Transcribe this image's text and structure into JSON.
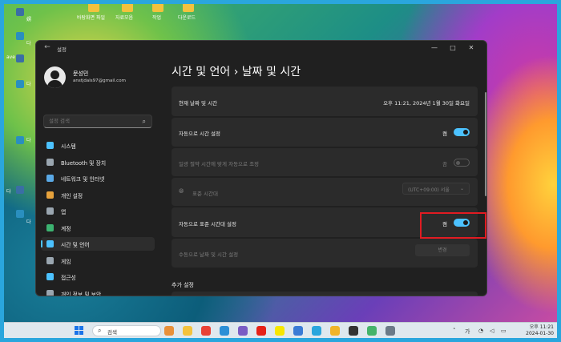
{
  "desktop": {
    "icons": [
      {
        "label": "바탕화면 파일"
      },
      {
        "label": "자료모음"
      },
      {
        "label": "작업"
      },
      {
        "label": "다운로드"
      }
    ],
    "left_labels": [
      "娚",
      "다",
      "ave",
      "다",
      "다",
      "다",
      "다"
    ]
  },
  "window": {
    "app_title": "설정",
    "back_glyph": "←",
    "minimize_glyph": "—",
    "maximize_glyph": "□",
    "close_glyph": "✕"
  },
  "user": {
    "name": "문성민",
    "email": "anstjdals97@gmail.com"
  },
  "search": {
    "placeholder": "설정 검색",
    "icon": "search-icon"
  },
  "nav": [
    {
      "label": "시스템",
      "icon": "monitor-icon",
      "color": "#4cc2ff"
    },
    {
      "label": "Bluetooth 및 장치",
      "icon": "bluetooth-devices-icon",
      "color": "#9aa6b0"
    },
    {
      "label": "네트워크 및 인터넷",
      "icon": "network-icon",
      "color": "#5aa9e6"
    },
    {
      "label": "개인 설정",
      "icon": "brush-icon",
      "color": "#e6a23c"
    },
    {
      "label": "앱",
      "icon": "apps-icon",
      "color": "#9aa6b0"
    },
    {
      "label": "계정",
      "icon": "account-icon",
      "color": "#3cb371"
    },
    {
      "label": "시간 및 언어",
      "icon": "globe-clock-icon",
      "color": "#4cc2ff",
      "active": true
    },
    {
      "label": "게임",
      "icon": "gamepad-icon",
      "color": "#9aa6b0"
    },
    {
      "label": "접근성",
      "icon": "accessibility-icon",
      "color": "#4cc2ff"
    },
    {
      "label": "개인 정보 및 보안",
      "icon": "shield-icon",
      "color": "#9aa6b0"
    }
  ],
  "page": {
    "title": "시간 및 언어  ›  날짜 및 시간"
  },
  "rows": {
    "current_label": "현재 날짜 및 시간",
    "current_value": "오후 11:21, 2024년 1월 30일 화요일",
    "auto_time_label": "자동으로 시간 설정",
    "auto_time_state": "켬",
    "dst_label": "일광 절약 시간에 맞게 자동으로 조정",
    "dst_state": "끔",
    "timezone_label": "표준 시간대",
    "timezone_value": "(UTC+09:00) 서울",
    "auto_tz_label": "자동으로 표준 시간대 설정",
    "auto_tz_state": "켬",
    "manual_label": "수동으로 날짜 및 시간 설정",
    "change_button": "변경"
  },
  "section": {
    "extra": "추가 설정"
  },
  "taskbar": {
    "search_label": "검색",
    "search_glyph": "⌕",
    "tray_chevron": "˄",
    "tray_lang": "가",
    "time": "오후 11:21",
    "date": "2024-01-30",
    "apps": [
      {
        "icon": "game-app-icon",
        "color": "#e8903a"
      },
      {
        "icon": "explorer-folder-icon",
        "color": "#f3c23d"
      },
      {
        "icon": "chrome-icon",
        "color": "#e94235"
      },
      {
        "icon": "edge-icon",
        "color": "#2b8fd6"
      },
      {
        "icon": "media-icon",
        "color": "#7a5cc4"
      },
      {
        "icon": "youtube-icon",
        "color": "#e62117"
      },
      {
        "icon": "kakaotalk-icon",
        "color": "#f7e600"
      },
      {
        "icon": "store-icon",
        "color": "#3a7bd5"
      },
      {
        "icon": "photos-icon",
        "color": "#2aa6dd"
      },
      {
        "icon": "files-icon",
        "color": "#f0b429"
      },
      {
        "icon": "terminal-icon",
        "color": "#333333"
      },
      {
        "icon": "app-icon",
        "color": "#44b36a"
      },
      {
        "icon": "settings-icon",
        "color": "#6b7a88"
      }
    ]
  }
}
